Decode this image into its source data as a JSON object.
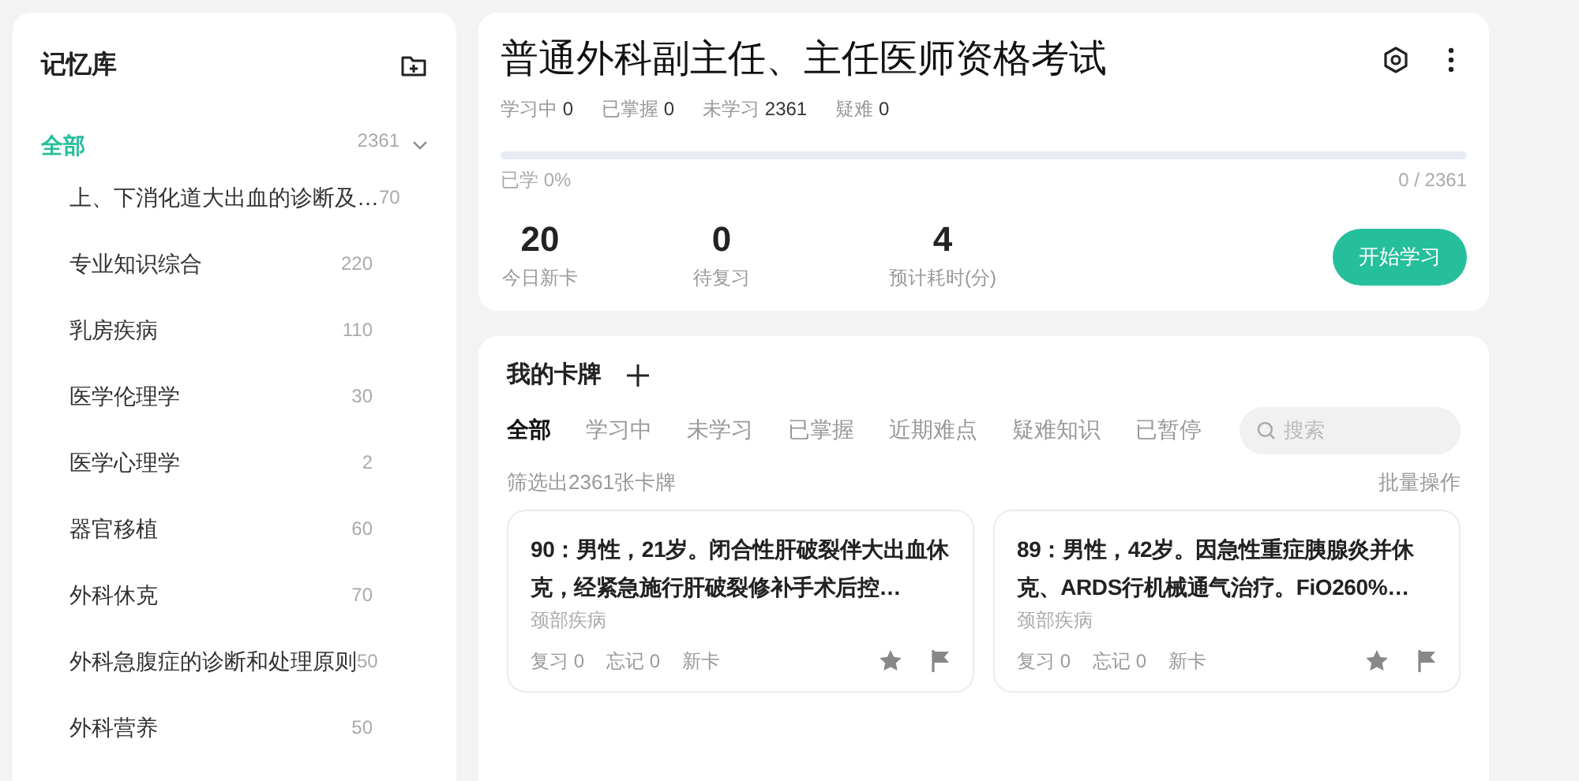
{
  "sidebar": {
    "title": "记忆库",
    "root": {
      "label": "全部",
      "count": "2361",
      "selected": true,
      "expanded": true
    },
    "items": [
      {
        "label": "上、下消化道大出血的诊断及…",
        "count": "70",
        "selected": false
      },
      {
        "label": "专业知识综合",
        "count": "220",
        "selected": false
      },
      {
        "label": "乳房疾病",
        "count": "110",
        "selected": false
      },
      {
        "label": "医学伦理学",
        "count": "30",
        "selected": false
      },
      {
        "label": "医学心理学",
        "count": "2",
        "selected": false
      },
      {
        "label": "器官移植",
        "count": "60",
        "selected": false
      },
      {
        "label": "外科休克",
        "count": "70",
        "selected": false
      },
      {
        "label": "外科急腹症的诊断和处理原则",
        "count": "50",
        "selected": false
      },
      {
        "label": "外科营养",
        "count": "50",
        "selected": false
      }
    ]
  },
  "deck": {
    "title": "普通外科副主任、主任医师资格考试",
    "stats": [
      {
        "label": "学习中",
        "value": "0"
      },
      {
        "label": "已掌握",
        "value": "0"
      },
      {
        "label": "未学习",
        "value": "2361"
      },
      {
        "label": "疑难",
        "value": "0"
      }
    ],
    "progress": {
      "level": 0,
      "label": "已学 0%",
      "reading": "0 / 2361"
    },
    "summary": [
      {
        "value": "20",
        "label": "今日新卡"
      },
      {
        "value": "0",
        "label": "待复习"
      },
      {
        "value": "4",
        "label": "预计耗时(分)"
      }
    ],
    "start_button": "开始学习"
  },
  "cards_panel": {
    "title": "我的卡牌",
    "filters": [
      {
        "label": "全部",
        "selected": true
      },
      {
        "label": "学习中",
        "selected": false
      },
      {
        "label": "未学习",
        "selected": false
      },
      {
        "label": "已掌握",
        "selected": false
      },
      {
        "label": "近期难点",
        "selected": false
      },
      {
        "label": "疑难知识",
        "selected": false
      },
      {
        "label": "已暂停",
        "selected": false
      }
    ],
    "search": {
      "placeholder": "搜索"
    },
    "result_text": "筛选出2361张卡牌",
    "batch_button": "批量操作",
    "cards": [
      {
        "title": "90：男性，21岁。闭合性肝破裂伴大出血休克，经紧急施行肝破裂修补手术后控…",
        "tag": "颈部疾病",
        "review": "复习 0",
        "forget": "忘记 0",
        "status": "新卡"
      },
      {
        "title": "89：男性，42岁。因急性重症胰腺炎并休克、ARDS行机械通气治疗。FiO260%…",
        "tag": "颈部疾病",
        "review": "复习 0",
        "forget": "忘记 0",
        "status": "新卡"
      }
    ]
  }
}
